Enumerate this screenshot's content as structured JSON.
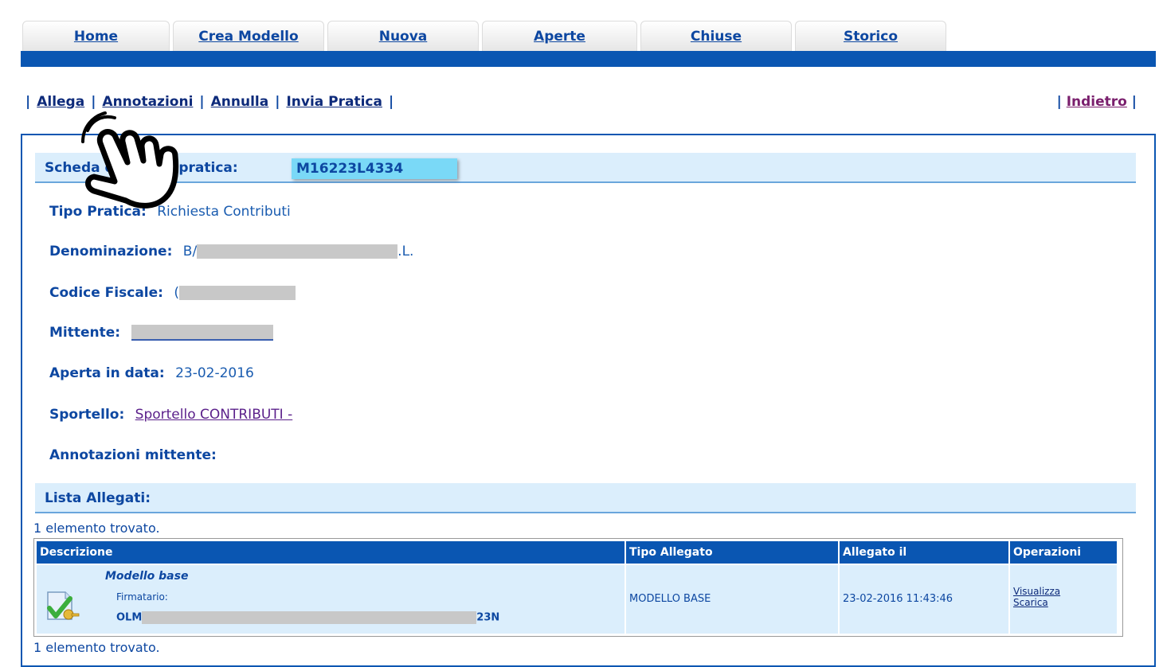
{
  "tabs": [
    "Home",
    "Crea Modello",
    "Nuova",
    "Aperte",
    "Chiuse",
    "Storico"
  ],
  "actions": [
    "Allega",
    "Annotazioni",
    "Annulla",
    "Invia Pratica"
  ],
  "back_label": "Indietro",
  "detail": {
    "title": "Scheda dettaglio pratica:",
    "code": "M16223L4334",
    "tipo_label": "Tipo Pratica:",
    "tipo_value": "Richiesta Contributi",
    "denominazione_label": "Denominazione:",
    "denominazione_prefix": "B/",
    "denominazione_suffix": ".L.",
    "codice_fiscale_label": "Codice Fiscale:",
    "codice_fiscale_prefix": "(",
    "mittente_label": "Mittente:",
    "aperta_label": "Aperta in data:",
    "aperta_value": "23-02-2016",
    "sportello_label": "Sportello:",
    "sportello_value": "Sportello CONTRIBUTI -",
    "annotazioni_label": "Annotazioni mittente:"
  },
  "allegati": {
    "title": "Lista Allegati:",
    "found_text": "1 elemento trovato.",
    "columns": [
      "Descrizione",
      "Tipo Allegato",
      "Allegato il",
      "Operazioni"
    ],
    "rows": [
      {
        "descrizione": "Modello base",
        "firmatario_label": "Firmatario:",
        "firmatario_prefix": "OLM",
        "firmatario_suffix": "23N",
        "tipo": "MODELLO BASE",
        "data": "23-02-2016 11:43:46",
        "op_visualizza": "Visualizza",
        "op_scarica": "Scarica"
      }
    ]
  },
  "colors": {
    "primary": "#0a56b2",
    "header_bg": "#dbeefc",
    "highlight": "#7ad9f7",
    "text": "#0d47a1"
  },
  "icons": {
    "cursor": "hand-pointer-icon",
    "attachment": "signed-document-icon"
  }
}
